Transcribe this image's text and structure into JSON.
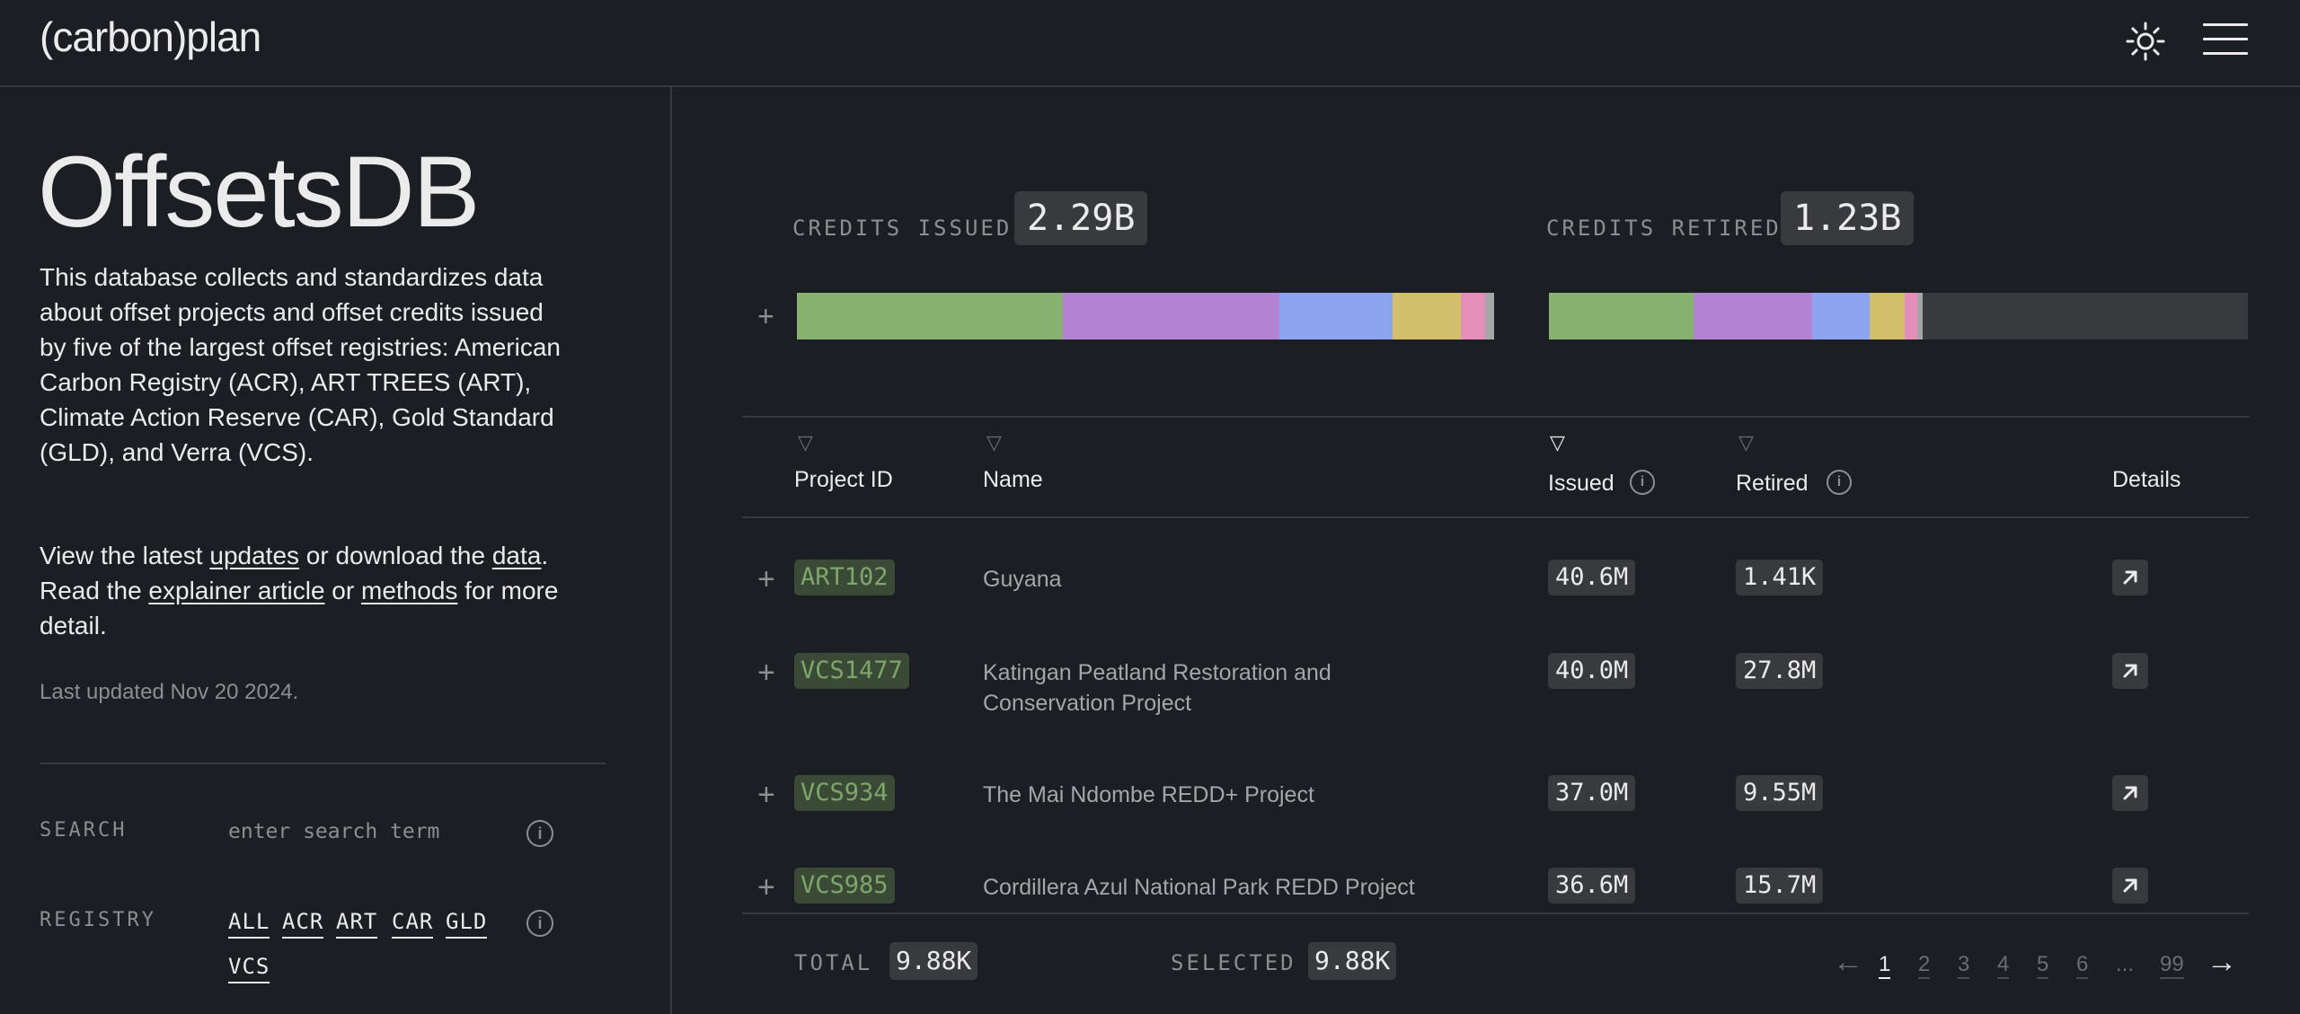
{
  "header": {
    "logo": "(carbon)plan",
    "theme_toggle_icon": "sun-icon",
    "menu_icon": "hamburger-menu-icon"
  },
  "sidebar": {
    "title": "OffsetsDB",
    "description": "This database collects and standardizes data about offset projects and offset credits issued by five of the largest offset registries: American Carbon Registry (ACR), ART TREES (ART), Climate Action Reserve (CAR), Gold Standard (GLD), and Verra (VCS).",
    "links_text": {
      "part1": "View the latest ",
      "updates": "updates",
      "part2": " or download the ",
      "data": "data",
      "part3": ". Read the ",
      "explainer": "explainer article",
      "part4": " or ",
      "methods": "methods",
      "part5": " for more detail."
    },
    "last_updated": "Last updated Nov 20 2024.",
    "search": {
      "label": "SEARCH",
      "placeholder": "enter search term"
    },
    "registry": {
      "label": "REGISTRY",
      "options": [
        "ALL",
        "ACR",
        "ART",
        "CAR",
        "GLD",
        "VCS"
      ]
    }
  },
  "stats": {
    "issued": {
      "label": "CREDITS ISSUED",
      "value": "2.29B"
    },
    "retired": {
      "label": "CREDITS RETIRED",
      "value": "1.23B"
    }
  },
  "colors": {
    "green": "#86b16f",
    "purple": "#b283d3",
    "blue": "#8da4f0",
    "yellow": "#d2bf6c",
    "pink": "#e38fb9",
    "grey": "#a5a6a8",
    "empty": "#393a3d"
  },
  "table": {
    "columns": {
      "project_id": "Project ID",
      "name": "Name",
      "issued": "Issued",
      "retired": "Retired",
      "details": "Details"
    },
    "rows": [
      {
        "id": "ART102",
        "name": "Guyana",
        "issued": "40.6M",
        "retired": "1.41K"
      },
      {
        "id": "VCS1477",
        "name": "Katingan Peatland Restoration and Conservation Project",
        "issued": "40.0M",
        "retired": "27.8M"
      },
      {
        "id": "VCS934",
        "name": "The Mai Ndombe REDD+ Project",
        "issued": "37.0M",
        "retired": "9.55M"
      },
      {
        "id": "VCS985",
        "name": "Cordillera Azul National Park REDD Project",
        "issued": "36.6M",
        "retired": "15.7M"
      }
    ]
  },
  "footer": {
    "total_label": "TOTAL",
    "total_value": "9.88K",
    "selected_label": "SELECTED",
    "selected_value": "9.88K",
    "pages": [
      "1",
      "2",
      "3",
      "4",
      "5",
      "6",
      "...",
      "99"
    ],
    "current_page": "1"
  }
}
